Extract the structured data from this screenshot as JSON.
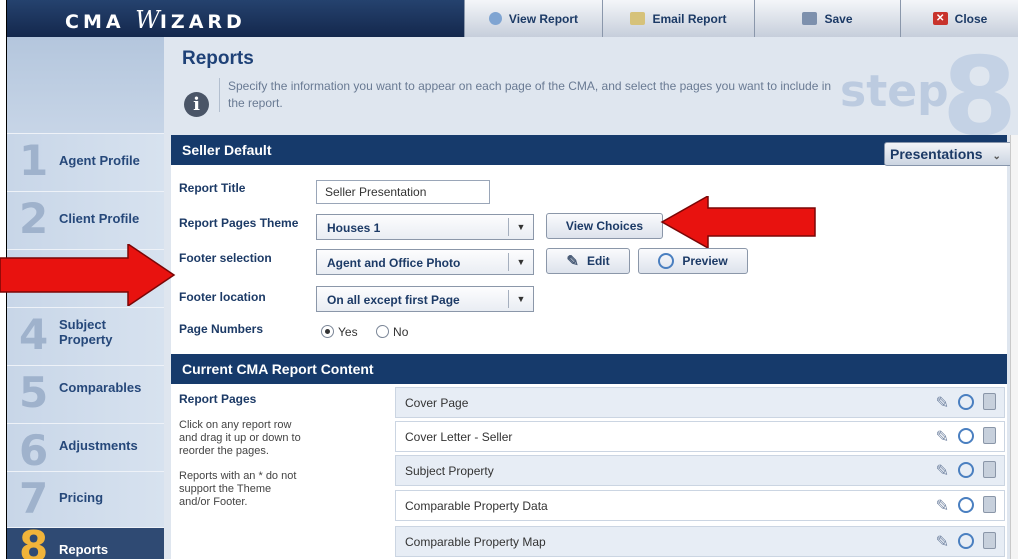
{
  "app": {
    "logo_a": "CMA ",
    "logo_w": "W",
    "logo_b": "IZARD"
  },
  "toolbar": {
    "view_report": "View Report",
    "email_report": "Email Report",
    "save": "Save",
    "close": "Close"
  },
  "nav": [
    {
      "num": "1",
      "label": "Agent Profile"
    },
    {
      "num": "2",
      "label": "Client Profile"
    },
    {
      "num": "4",
      "label": "Subject",
      "label2": "Property"
    },
    {
      "num": "5",
      "label": "Comparables"
    },
    {
      "num": "6",
      "label": "Adjustments"
    },
    {
      "num": "7",
      "label": "Pricing"
    },
    {
      "num": "8",
      "label": "Reports"
    }
  ],
  "header": {
    "title": "Reports",
    "description": "Specify the information you want to appear on each page of the CMA, and select the pages you want to include in the report.",
    "step_word": "step",
    "step_num": "8"
  },
  "seller_default": {
    "title": "Seller Default",
    "presentations_button": "Presentations",
    "report_title_label": "Report Title",
    "report_title_value": "Seller Presentation",
    "theme_label": "Report Pages Theme",
    "theme_value": "Houses 1",
    "view_choices": "View Choices",
    "footer_label": "Footer selection",
    "footer_value": "Agent and Office Photo",
    "edit": "Edit",
    "preview": "Preview",
    "footer_location_label": "Footer location",
    "footer_location_value": "On all except first Page",
    "page_numbers_label": "Page Numbers",
    "yes": "Yes",
    "no": "No",
    "page_numbers_selected": "Yes"
  },
  "content": {
    "title": "Current CMA Report Content",
    "report_pages_label": "Report Pages",
    "help1": "Click on any report row and drag it up or down to reorder the pages.",
    "help2": "Reports with an * do not support the Theme and/or Footer.",
    "rows": [
      {
        "name": "Cover Page"
      },
      {
        "name": "Cover Letter - Seller"
      },
      {
        "name": "Subject Property"
      },
      {
        "name": "Comparable Property Data"
      },
      {
        "name": "Comparable Property Map"
      }
    ]
  },
  "colors": {
    "accent": "#163a6b",
    "annotation_arrow": "#e8120f"
  }
}
